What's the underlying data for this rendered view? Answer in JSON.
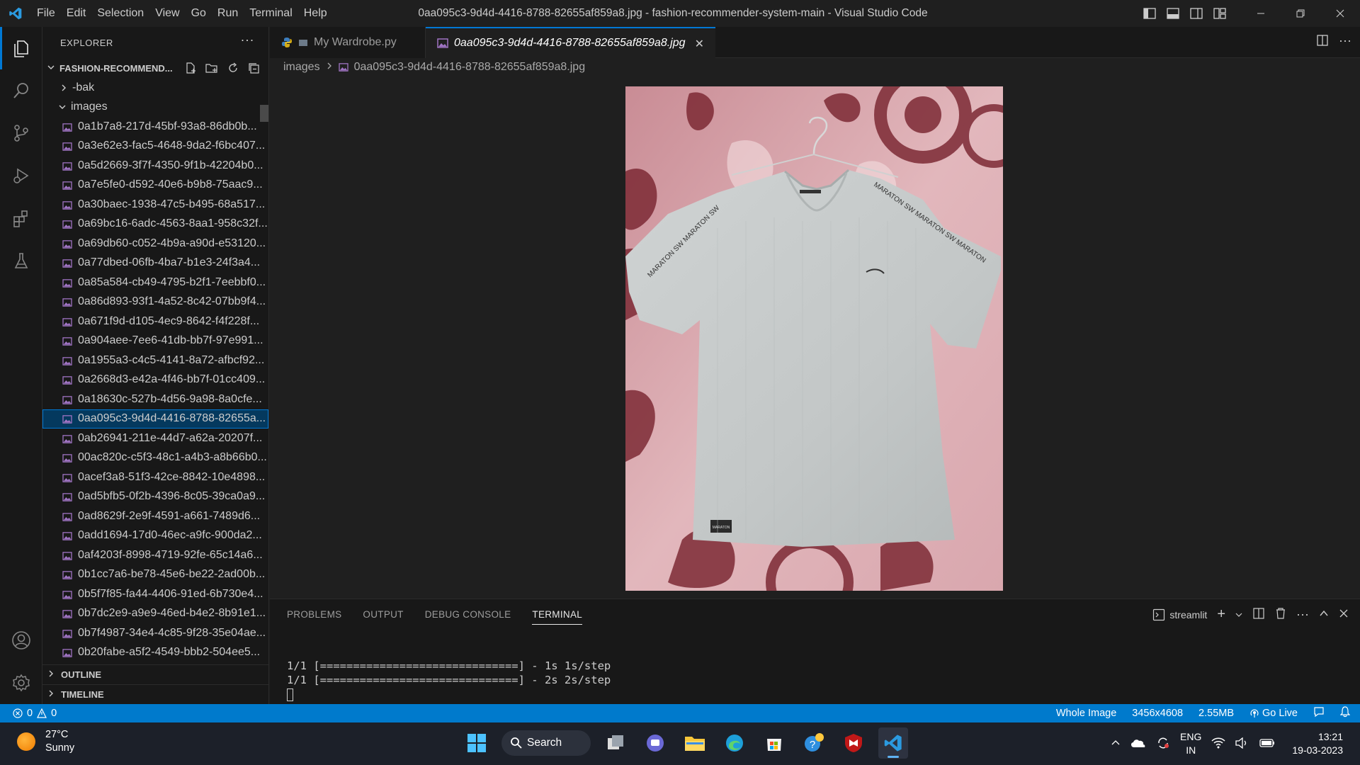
{
  "window": {
    "title": "0aa095c3-9d4d-4416-8788-82655af859a8.jpg - fashion-recommender-system-main - Visual Studio Code"
  },
  "menu": [
    "File",
    "Edit",
    "Selection",
    "View",
    "Go",
    "Run",
    "Terminal",
    "Help"
  ],
  "sidebar": {
    "header": "EXPLORER",
    "root_folder": "FASHION-RECOMMEND...",
    "folders": {
      "bak": "-bak",
      "images": "images"
    },
    "files": [
      "0a1b7a8-217d-45bf-93a8-86db0b...",
      "0a3e62e3-fac5-4648-9da2-f6bc407...",
      "0a5d2669-3f7f-4350-9f1b-42204b0...",
      "0a7e5fe0-d592-40e6-b9b8-75aac9...",
      "0a30baec-1938-47c5-b495-68a517...",
      "0a69bc16-6adc-4563-8aa1-958c32f...",
      "0a69db60-c052-4b9a-a90d-e53120...",
      "0a77dbed-06fb-4ba7-b1e3-24f3a4...",
      "0a85a584-cb49-4795-b2f1-7eebbf0...",
      "0a86d893-93f1-4a52-8c42-07bb9f4...",
      "0a671f9d-d105-4ec9-8642-f4f228f...",
      "0a904aee-7ee6-41db-bb7f-97e991...",
      "0a1955a3-c4c5-4141-8a72-afbcf92...",
      "0a2668d3-e42a-4f46-bb7f-01cc409...",
      "0a18630c-527b-4d56-9a98-8a0cfe...",
      "0aa095c3-9d4d-4416-8788-82655a...",
      "0ab26941-211e-44d7-a62a-20207f...",
      "00ac820c-c5f3-48c1-a4b3-a8b66b0...",
      "0acef3a8-51f3-42ce-8842-10e4898...",
      "0ad5bfb5-0f2b-4396-8c05-39ca0a9...",
      "0ad8629f-2e9f-4591-a661-7489d6...",
      "0add1694-17d0-46ec-a9fc-900da2...",
      "0af4203f-8998-4719-92fe-65c14a6...",
      "0b1cc7a6-be78-45e6-be22-2ad00b...",
      "0b5f7f85-fa44-4406-91ed-6b730e4...",
      "0b7dc2e9-a9e9-46ed-b4e2-8b91e1...",
      "0b7f4987-34e4-4c85-9f28-35e04ae...",
      "0b20fabe-a5f2-4549-bbb2-504ee5..."
    ],
    "outline": "OUTLINE",
    "timeline": "TIMELINE"
  },
  "tabs": [
    {
      "label": "My Wardrobe.py"
    },
    {
      "label": "0aa095c3-9d4d-4416-8788-82655af859a8.jpg"
    }
  ],
  "breadcrumb": {
    "folder": "images",
    "file": "0aa095c3-9d4d-4416-8788-82655af859a8.jpg"
  },
  "image": {
    "shirt_print_left": "MARATON SW MARATON SW",
    "shirt_print_right": "MARATON SW MARATON SW MARATON",
    "tag": "MARATON"
  },
  "panel": {
    "tabs": [
      "PROBLEMS",
      "OUTPUT",
      "DEBUG CONSOLE",
      "TERMINAL"
    ],
    "terminal_name": "streamlit",
    "lines": [
      "1/1 [==============================] - 1s 1s/step",
      "1/1 [==============================] - 2s 2s/step"
    ]
  },
  "status": {
    "errors": "0",
    "warnings": "0",
    "mode": "Whole Image",
    "dimensions": "3456x4608",
    "size": "2.55MB",
    "golive": "Go Live"
  },
  "taskbar": {
    "temp": "27°C",
    "weather": "Sunny",
    "search": "Search",
    "lang1": "ENG",
    "lang2": "IN",
    "time": "13:21",
    "date": "19-03-2023"
  },
  "colors": {
    "accent": "#007acc",
    "selection": "#04395e",
    "file_icon": "#a074c4"
  }
}
